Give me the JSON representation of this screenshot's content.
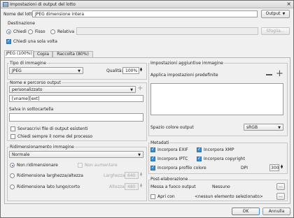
{
  "window": {
    "title": "Impostazioni di output del lotto",
    "close_icon": "close-icon"
  },
  "batch_name": {
    "label": "Nome del lotto:",
    "value": "JPEG dimensione intera"
  },
  "output_button": "Output",
  "destination": {
    "label": "Destinazione",
    "options": [
      "Chiedi",
      "Fisso",
      "Relativa"
    ],
    "selected": "Chiedi",
    "browse": "Sfoglia...",
    "ask_once": "Chiedi una sola volta"
  },
  "tabs": [
    {
      "label": "JPEG (100%)"
    },
    {
      "label": "Copia"
    },
    {
      "label": "Raccolta (80%)"
    }
  ],
  "image_type": {
    "label": "Tipo di immagine",
    "value": "JPEG",
    "quality_label": "Qualità:",
    "quality": "100%"
  },
  "name_path": {
    "label": "Nome e percorso output",
    "preset": "personalizzato",
    "pattern": "[vname][ext]"
  },
  "subfolder": {
    "label": "Salva in sottocartella",
    "overwrite": "Sovrascrivi file di output esistenti",
    "ask_name": "Chiedi sempre il nome del processo"
  },
  "resize": {
    "label": "Ridimensionamento immagine",
    "mode": "Normale",
    "no_resize": "Non ridimensionare",
    "no_enlarge": "Non aumentare",
    "by_width": "Ridimensiona larghezza/altezza",
    "width_label": "Larghezza",
    "width": "640",
    "by_long": "Ridimensiona lato lungo/corto",
    "height_label": "Altezza",
    "height": "480"
  },
  "extra": {
    "label": "Impostazioni aggiuntive immagine",
    "apply_presets": "Applica impostazioni predefinite"
  },
  "color_space": {
    "label": "Spazio colore output",
    "value": "sRGB"
  },
  "metadata": {
    "label": "Metadati",
    "exif": "Incorpora EXIF",
    "xmp": "Incorpora XMP",
    "iptc": "Incorpora IPTC",
    "copyright": "Incorpora copyright",
    "profile": "Incorpora profilo colore",
    "dpi_label": "DPI",
    "dpi": "300"
  },
  "post": {
    "label": "Post-elaborazione",
    "focus_label": "Messa a fuoco output",
    "focus_value": "Nessuno",
    "open_with": "Apri con",
    "open_value": "<nessun elemento selezionato>",
    "more": "..."
  },
  "ok": "OK",
  "cancel": "Annulla",
  "accent_color": "#3a8fd9"
}
